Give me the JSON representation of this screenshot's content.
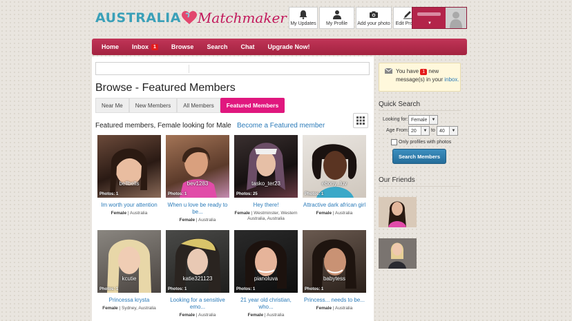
{
  "logo": {
    "part1": "AUSTRALIA",
    "part2": "Matchmaker"
  },
  "toolbar": [
    {
      "label": "My Updates",
      "icon": "bell-icon"
    },
    {
      "label": "My Profile",
      "icon": "person-icon"
    },
    {
      "label": "Add your photo",
      "icon": "camera-icon"
    },
    {
      "label": "Edit Profile",
      "icon": "pencil-icon"
    }
  ],
  "user": {
    "caret": "▼"
  },
  "nav": {
    "items": [
      {
        "label": "Home"
      },
      {
        "label": "Inbox",
        "badge": "1"
      },
      {
        "label": "Browse"
      },
      {
        "label": "Search"
      },
      {
        "label": "Chat"
      },
      {
        "label": "Upgrade Now!"
      }
    ]
  },
  "main": {
    "title": "Browse - Featured Members",
    "tabs": [
      "Near Me",
      "New Members",
      "All Members",
      "Featured Members"
    ],
    "featured_text": "Featured members, Female looking for Male",
    "featured_link": "Become a Featured member"
  },
  "members": [
    {
      "username": "bellbells",
      "photos": "Photos: 1",
      "headline": "Im worth your attention",
      "gender": "Female",
      "location": "Australia"
    },
    {
      "username": "bev1283",
      "photos": "Photos: 1",
      "headline": "When u love be ready to be...",
      "gender": "Female",
      "location": "Australia"
    },
    {
      "username": "tasko_ter23",
      "photos": "Photos: 25",
      "headline": "Hey there!",
      "gender": "Female",
      "location": "Westminster, Western Australia, Australia"
    },
    {
      "username": "ebony_luv",
      "photos": "Photos: 1",
      "headline": "Attractive dark african girl",
      "gender": "Female",
      "location": "Australia"
    },
    {
      "username": "kcutie",
      "photos": "Photos: 1",
      "headline": "Princessa krysta",
      "gender": "Female",
      "location": "Sydney, Australia"
    },
    {
      "username": "katie321123",
      "photos": "Photos: 1",
      "headline": "Looking for a sensitive emo...",
      "gender": "Female",
      "location": "Australia"
    },
    {
      "username": "pianoluva",
      "photos": "Photos: 1",
      "headline": "21 year old christian, who...",
      "gender": "Female",
      "location": "Australia"
    },
    {
      "username": "babytess",
      "photos": "Photos: 1",
      "headline": "Princess... needs to be...",
      "gender": "Female",
      "location": "Australia"
    }
  ],
  "sidebar": {
    "notice": {
      "pre": "You have ",
      "count": "1",
      "post": " new message(s) in your ",
      "link": "inbox."
    },
    "quick_search": {
      "title": "Quick Search",
      "looking_for_label": "Looking for",
      "looking_for_value": "Female",
      "age_from_label": "Age From",
      "age_from": "20",
      "to_label": "to",
      "age_to": "40",
      "photos_only_label": "Only profiles with photos",
      "search_button": "Search Members"
    },
    "friends_title": "Our Friends"
  }
}
